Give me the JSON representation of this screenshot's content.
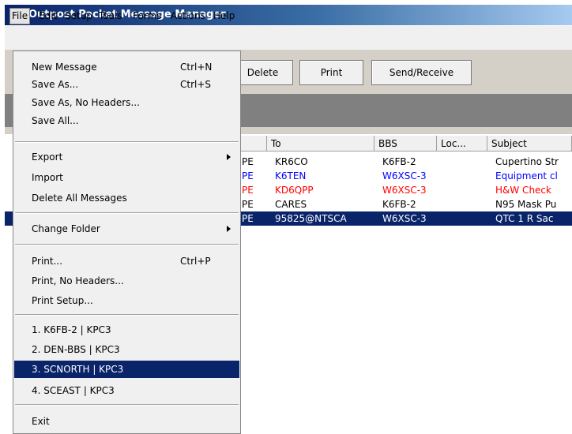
{
  "window": {
    "title": "Outpost Packet Message Manager"
  },
  "menubar": [
    "File",
    "Edit",
    "Setup",
    "Tools",
    "Forms",
    "Actions",
    "Help"
  ],
  "toolbar": {
    "delete": "Delete",
    "print": "Print",
    "send_receive": "Send/Receive"
  },
  "file_menu": {
    "new_message": "New Message",
    "new_message_sc": "Ctrl+N",
    "save_as": "Save As...",
    "save_as_sc": "Ctrl+S",
    "save_as_no_headers": "Save As, No Headers...",
    "save_all": "Save All...",
    "export": "Export",
    "import": "Import",
    "delete_all": "Delete All Messages",
    "change_folder": "Change Folder",
    "print": "Print...",
    "print_sc": "Ctrl+P",
    "print_no_headers": "Print, No Headers...",
    "print_setup": "Print Setup...",
    "recent1": "1. K6FB-2 | KPC3",
    "recent2": "2. DEN-BBS | KPC3",
    "recent3": "3. SCNORTH | KPC3",
    "recent4": "4. SCEAST | KPC3",
    "exit": "Exit"
  },
  "list": {
    "headers": {
      "from": "n",
      "to": "To",
      "bbs": "BBS",
      "loc": "Loc...",
      "subject": "Subject"
    },
    "rows": [
      {
        "from": "PE",
        "to": "KR6CO",
        "bbs": "K6FB-2",
        "loc": "",
        "subject": "Cupertino Str",
        "color": "#000000"
      },
      {
        "from": "PE",
        "to": "K6TEN",
        "bbs": "W6XSC-3",
        "loc": "",
        "subject": "Equipment cl",
        "color": "#0000ff"
      },
      {
        "from": "PE",
        "to": "KD6QPP",
        "bbs": "W6XSC-3",
        "loc": "",
        "subject": "H&W Check",
        "color": "#ff0000"
      },
      {
        "from": "PE",
        "to": "CARES",
        "bbs": "K6FB-2",
        "loc": "",
        "subject": "N95 Mask Pu",
        "color": "#000000"
      },
      {
        "from": "PE",
        "to": "95825@NTSCA",
        "bbs": "W6XSC-3",
        "loc": "",
        "subject": "QTC 1 R Sac",
        "color": "#ffffff"
      }
    ]
  }
}
